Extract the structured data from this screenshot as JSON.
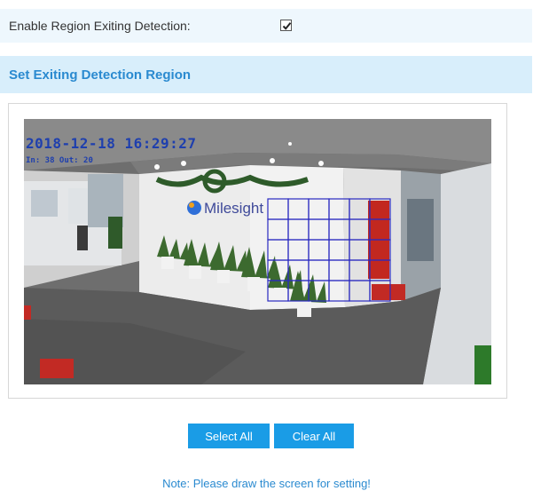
{
  "enable_row": {
    "label": "Enable Region Exiting Detection:",
    "checked": true
  },
  "section": {
    "title": "Set Exiting Detection Region"
  },
  "video": {
    "timestamp": "2018-12-18 16:29:27",
    "counter": "In: 38  Out: 20",
    "logo_text": "Milesight"
  },
  "region_grid": {
    "rows": 5,
    "cols": 6,
    "color": "#2a2ac0"
  },
  "buttons": {
    "select_all": "Select All",
    "clear_all": "Clear All"
  },
  "note": "Note: Please draw the screen for setting!",
  "colors": {
    "accent": "#1a9ce6",
    "header_bg": "#d8eefb",
    "header_text": "#2a8ad0"
  }
}
